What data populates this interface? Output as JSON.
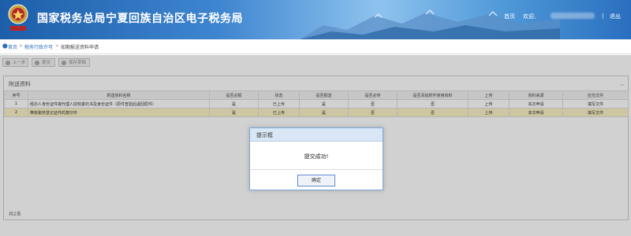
{
  "header": {
    "title": "国家税务总局宁夏回族自治区电子税务局",
    "home_link": "首页",
    "welcome": "欢迎,",
    "separator": "|",
    "logout": "退出",
    "emblem_text": "中国税务"
  },
  "breadcrumb": {
    "items": [
      "首页",
      ">",
      "税务行政许可",
      ">",
      "如期报送资料申请"
    ]
  },
  "toolbar": {
    "buttons": [
      {
        "label": "上一步",
        "icon": "arrow-left-icon"
      },
      {
        "label": "提交",
        "icon": "submit-icon"
      },
      {
        "label": "保存草稿",
        "icon": "save-icon"
      }
    ]
  },
  "panel": {
    "title": "附送资料",
    "collapse_icon": "chevron-up-icon",
    "columns": [
      "序号",
      "附送资料名称",
      "是否必报",
      "状态",
      "是否报送",
      "是否必传",
      "是否添加附件使用资料",
      "上传",
      "资料来源",
      "应交文件"
    ],
    "rows": [
      [
        "1",
        "经办人身份证件或代理人授权委托书及身份证件（原件查验后退回原件）",
        "是",
        "已上传",
        "是",
        "否",
        "否",
        "上传",
        "本次申请",
        "填写文件"
      ],
      [
        "2",
        "带有税务登记证件的复印件",
        "是",
        "已上传",
        "是",
        "否",
        "否",
        "上传",
        "本次申请",
        "填写文件"
      ]
    ],
    "footer": "共2条"
  },
  "dialog": {
    "title": "提示框",
    "message": "提交成功!",
    "ok_label": "确定"
  },
  "colors": {
    "header_blue": "#1c5ea9",
    "selected_row": "#fbf2c4",
    "dialog_title_bg": "#d8e6f5"
  }
}
